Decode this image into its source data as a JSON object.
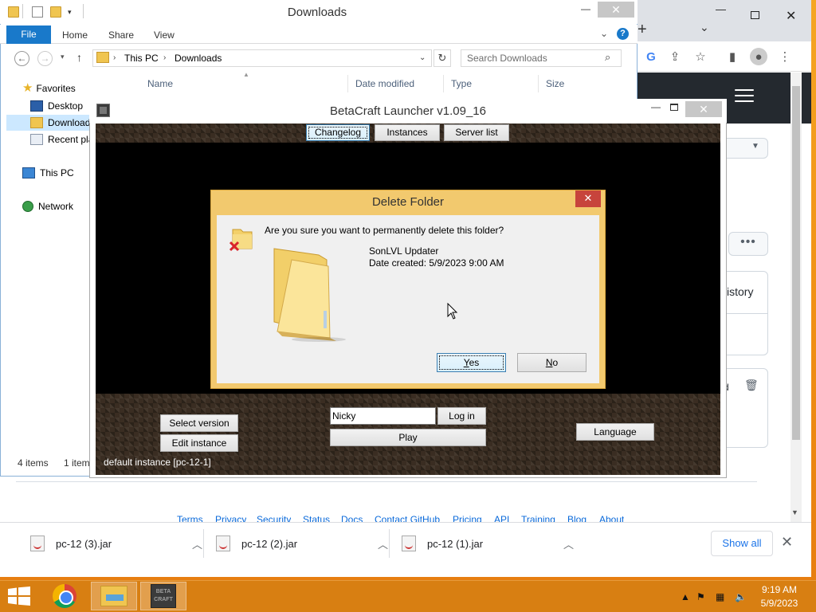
{
  "chrome": {
    "footer_links": [
      "Terms",
      "Privacy",
      "Security",
      "Status",
      "Docs",
      "Contact GitHub",
      "Pricing",
      "API",
      "Training",
      "Blog",
      "About"
    ],
    "github_history": "istory",
    "github_row_label": "d",
    "downloads": [
      {
        "name": "pc-12 (3).jar"
      },
      {
        "name": "pc-12 (2).jar"
      },
      {
        "name": "pc-12 (1).jar"
      }
    ],
    "show_all": "Show all"
  },
  "explorer": {
    "title": "Downloads",
    "ribbon": {
      "file": "File",
      "tabs": [
        "Home",
        "Share",
        "View"
      ]
    },
    "address": {
      "segments": [
        "This PC",
        "Downloads"
      ]
    },
    "search_placeholder": "Search Downloads",
    "columns": [
      "Name",
      "Date modified",
      "Type",
      "Size"
    ],
    "nav": {
      "favorites": "Favorites",
      "desktop": "Desktop",
      "downloads": "Download",
      "recent": "Recent pla",
      "this_pc": "This PC",
      "network": "Network"
    },
    "status_items": "4 items",
    "status_selected": "1 item"
  },
  "betacraft": {
    "title": "BetaCraft Launcher v1.09_16",
    "tabs": [
      "Changelog",
      "Instances",
      "Server list"
    ],
    "select_version": "Select version",
    "edit_instance": "Edit instance",
    "username_value": "Nicky",
    "login": "Log in",
    "play": "Play",
    "language": "Language",
    "instance_label": "default instance [pc-12-1]"
  },
  "dialog": {
    "title": "Delete Folder",
    "question": "Are you sure you want to permanently delete this folder?",
    "folder_name": "SonLVL Updater",
    "date_created": "Date created: 5/9/2023 9:00 AM",
    "yes_mnemonic": "Y",
    "yes_rest": "es",
    "no_mnemonic": "N",
    "no_rest": "o"
  },
  "taskbar": {
    "time": "9:19 AM",
    "date": "5/9/2023",
    "betacraft_icon_text": "BETA CRAFT"
  },
  "colors": {
    "desktop": "#f29b1a",
    "taskbar": "#d87f12",
    "explorer_accent": "#1979ca",
    "dialog_frame": "#f2c96e",
    "dialog_close": "#c7443c",
    "github_header": "#24292f"
  }
}
